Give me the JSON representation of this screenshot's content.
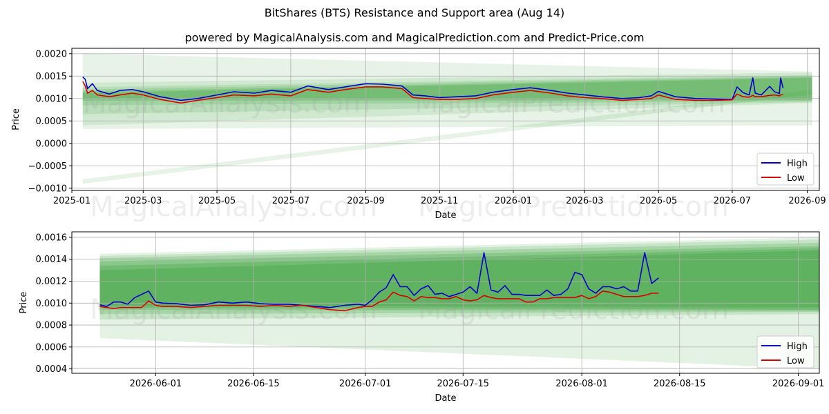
{
  "title": "BitShares (BTS) Resistance and Support area (Aug 14)",
  "subtitle": "powered by MagicalAnalysis.com and MagicalPrediction.com and Predict-Price.com",
  "watermark": [
    "MagicalAnalysis.com",
    "MagicalPrediction.com"
  ],
  "colors": {
    "high": "#0000cc",
    "low": "#dd0000",
    "band": "#2e9a2e"
  },
  "chart_data": [
    {
      "type": "line",
      "xlabel": "Date",
      "ylabel": "Price",
      "xlim": [
        "2025-01-01",
        "2026-09-11"
      ],
      "ylim": [
        -0.00105,
        0.00212
      ],
      "grid": true,
      "legend": "bottom-right",
      "x_ticks": [
        "2025-01",
        "2025-03",
        "2025-05",
        "2025-07",
        "2025-09",
        "2025-11",
        "2026-01",
        "2026-03",
        "2026-05",
        "2026-07",
        "2026-09"
      ],
      "y_ticks": [
        "0.0020",
        "0.0015",
        "0.0010",
        "0.0005",
        "0.0000",
        "−0.0005",
        "−0.0010"
      ],
      "series": [
        {
          "name": "High",
          "x": [
            "2025-01-10",
            "2025-01-12",
            "2025-01-14",
            "2025-01-18",
            "2025-01-22",
            "2025-02-01",
            "2025-02-10",
            "2025-02-20",
            "2025-03-01",
            "2025-03-15",
            "2025-04-01",
            "2025-04-15",
            "2025-05-01",
            "2025-05-15",
            "2025-06-01",
            "2025-06-15",
            "2025-07-01",
            "2025-07-15",
            "2025-08-01",
            "2025-08-15",
            "2025-09-01",
            "2025-09-15",
            "2025-10-01",
            "2025-10-10",
            "2025-10-20",
            "2025-11-01",
            "2025-11-15",
            "2025-12-01",
            "2025-12-15",
            "2026-01-01",
            "2026-01-15",
            "2026-02-01",
            "2026-02-15",
            "2026-03-01",
            "2026-03-15",
            "2026-04-01",
            "2026-04-15",
            "2026-04-25",
            "2026-05-01",
            "2026-05-15",
            "2026-06-01",
            "2026-06-15",
            "2026-07-01",
            "2026-07-05",
            "2026-07-10",
            "2026-07-15",
            "2026-07-18",
            "2026-07-20",
            "2026-07-25",
            "2026-08-01",
            "2026-08-05",
            "2026-08-09",
            "2026-08-10",
            "2026-08-12"
          ],
          "y": [
            0.00148,
            0.00143,
            0.00122,
            0.00133,
            0.00118,
            0.0011,
            0.00118,
            0.0012,
            0.00115,
            0.00104,
            0.00096,
            0.001,
            0.00108,
            0.00115,
            0.00112,
            0.00118,
            0.00114,
            0.00128,
            0.0012,
            0.00126,
            0.00133,
            0.00132,
            0.00128,
            0.00108,
            0.00106,
            0.00102,
            0.00104,
            0.00106,
            0.00114,
            0.0012,
            0.00124,
            0.00118,
            0.00112,
            0.00108,
            0.00104,
            0.001,
            0.00102,
            0.00106,
            0.00116,
            0.00104,
            0.001,
            0.00099,
            0.00098,
            0.00126,
            0.00113,
            0.00108,
            0.00146,
            0.00112,
            0.00108,
            0.00127,
            0.00115,
            0.00111,
            0.00146,
            0.00123
          ]
        },
        {
          "name": "Low",
          "x": [
            "2025-01-10",
            "2025-01-12",
            "2025-01-14",
            "2025-01-18",
            "2025-01-22",
            "2025-02-01",
            "2025-02-10",
            "2025-02-20",
            "2025-03-01",
            "2025-03-15",
            "2025-04-01",
            "2025-04-15",
            "2025-05-01",
            "2025-05-15",
            "2025-06-01",
            "2025-06-15",
            "2025-07-01",
            "2025-07-15",
            "2025-08-01",
            "2025-08-15",
            "2025-09-01",
            "2025-09-15",
            "2025-10-01",
            "2025-10-10",
            "2025-10-20",
            "2025-11-01",
            "2025-11-15",
            "2025-12-01",
            "2025-12-15",
            "2026-01-01",
            "2026-01-15",
            "2026-02-01",
            "2026-02-15",
            "2026-03-01",
            "2026-03-15",
            "2026-04-01",
            "2026-04-15",
            "2026-04-25",
            "2026-05-01",
            "2026-05-15",
            "2026-06-01",
            "2026-06-15",
            "2026-07-01",
            "2026-07-05",
            "2026-07-10",
            "2026-07-15",
            "2026-07-18",
            "2026-07-20",
            "2026-07-25",
            "2026-08-01",
            "2026-08-05",
            "2026-08-09",
            "2026-08-10",
            "2026-08-12"
          ],
          "y": [
            0.00138,
            0.00128,
            0.00112,
            0.00118,
            0.00108,
            0.00104,
            0.00108,
            0.00112,
            0.00108,
            0.00098,
            0.0009,
            0.00096,
            0.00102,
            0.00108,
            0.00106,
            0.0011,
            0.00106,
            0.0012,
            0.00114,
            0.0012,
            0.00126,
            0.00126,
            0.00122,
            0.00102,
            0.001,
            0.00098,
            0.00098,
            0.001,
            0.00108,
            0.00114,
            0.00118,
            0.00112,
            0.00106,
            0.00102,
            0.001,
            0.00096,
            0.00098,
            0.001,
            0.00108,
            0.00098,
            0.00096,
            0.00096,
            0.00097,
            0.0011,
            0.00104,
            0.00103,
            0.00107,
            0.00104,
            0.00104,
            0.00107,
            0.00108,
            0.00106,
            0.00108,
            0.00109
          ]
        }
      ]
    },
    {
      "type": "line",
      "xlabel": "Date",
      "ylabel": "Price",
      "xlim": [
        "2026-05-20",
        "2026-09-04"
      ],
      "ylim": [
        0.00036,
        0.00165
      ],
      "grid": true,
      "legend": "bottom-right",
      "x_ticks": [
        "2026-06-01",
        "2026-06-15",
        "2026-07-01",
        "2026-07-15",
        "2026-08-01",
        "2026-08-15",
        "2026-09-01"
      ],
      "y_ticks": [
        "0.0016",
        "0.0014",
        "0.0012",
        "0.0010",
        "0.0008",
        "0.0006",
        "0.0004"
      ],
      "series": [
        {
          "name": "High",
          "x": [
            "2026-05-24",
            "2026-05-25",
            "2026-05-26",
            "2026-05-27",
            "2026-05-28",
            "2026-05-29",
            "2026-05-30",
            "2026-05-31",
            "2026-06-01",
            "2026-06-02",
            "2026-06-04",
            "2026-06-06",
            "2026-06-08",
            "2026-06-10",
            "2026-06-12",
            "2026-06-14",
            "2026-06-16",
            "2026-06-18",
            "2026-06-20",
            "2026-06-22",
            "2026-06-24",
            "2026-06-26",
            "2026-06-28",
            "2026-06-30",
            "2026-07-01",
            "2026-07-02",
            "2026-07-03",
            "2026-07-04",
            "2026-07-05",
            "2026-07-06",
            "2026-07-07",
            "2026-07-08",
            "2026-07-09",
            "2026-07-10",
            "2026-07-11",
            "2026-07-12",
            "2026-07-13",
            "2026-07-14",
            "2026-07-15",
            "2026-07-16",
            "2026-07-17",
            "2026-07-18",
            "2026-07-19",
            "2026-07-20",
            "2026-07-21",
            "2026-07-22",
            "2026-07-23",
            "2026-07-24",
            "2026-07-25",
            "2026-07-26",
            "2026-07-27",
            "2026-07-28",
            "2026-07-29",
            "2026-07-30",
            "2026-07-31",
            "2026-08-01",
            "2026-08-02",
            "2026-08-03",
            "2026-08-04",
            "2026-08-05",
            "2026-08-06",
            "2026-08-07",
            "2026-08-08",
            "2026-08-09",
            "2026-08-10",
            "2026-08-11",
            "2026-08-12"
          ],
          "y": [
            0.000985,
            0.00097,
            0.00101,
            0.00101,
            0.00099,
            0.00105,
            0.00108,
            0.00111,
            0.00101,
            0.001,
            0.000995,
            0.00098,
            0.000985,
            0.00101,
            0.001,
            0.00101,
            0.000995,
            0.00099,
            0.00099,
            0.00098,
            0.00097,
            0.00096,
            0.00098,
            0.00099,
            0.00098,
            0.00103,
            0.0011,
            0.00114,
            0.00126,
            0.00115,
            0.00115,
            0.00107,
            0.00113,
            0.00116,
            0.00108,
            0.00109,
            0.00106,
            0.00108,
            0.0011,
            0.00115,
            0.00109,
            0.00146,
            0.00112,
            0.0011,
            0.00116,
            0.00108,
            0.00108,
            0.00107,
            0.00107,
            0.00107,
            0.00112,
            0.00107,
            0.00108,
            0.00113,
            0.00128,
            0.00126,
            0.00113,
            0.00109,
            0.00115,
            0.00115,
            0.00113,
            0.00115,
            0.00111,
            0.00111,
            0.00146,
            0.00118,
            0.00123
          ]
        },
        {
          "name": "Low",
          "x": [
            "2026-05-24",
            "2026-05-25",
            "2026-05-26",
            "2026-05-27",
            "2026-05-28",
            "2026-05-29",
            "2026-05-30",
            "2026-05-31",
            "2026-06-01",
            "2026-06-02",
            "2026-06-04",
            "2026-06-06",
            "2026-06-08",
            "2026-06-10",
            "2026-06-12",
            "2026-06-14",
            "2026-06-16",
            "2026-06-18",
            "2026-06-20",
            "2026-06-22",
            "2026-06-24",
            "2026-06-26",
            "2026-06-28",
            "2026-06-30",
            "2026-07-01",
            "2026-07-02",
            "2026-07-03",
            "2026-07-04",
            "2026-07-05",
            "2026-07-06",
            "2026-07-07",
            "2026-07-08",
            "2026-07-09",
            "2026-07-10",
            "2026-07-11",
            "2026-07-12",
            "2026-07-13",
            "2026-07-14",
            "2026-07-15",
            "2026-07-16",
            "2026-07-17",
            "2026-07-18",
            "2026-07-19",
            "2026-07-20",
            "2026-07-21",
            "2026-07-22",
            "2026-07-23",
            "2026-07-24",
            "2026-07-25",
            "2026-07-26",
            "2026-07-27",
            "2026-07-28",
            "2026-07-29",
            "2026-07-30",
            "2026-07-31",
            "2026-08-01",
            "2026-08-02",
            "2026-08-03",
            "2026-08-04",
            "2026-08-05",
            "2026-08-06",
            "2026-08-07",
            "2026-08-08",
            "2026-08-09",
            "2026-08-10",
            "2026-08-11",
            "2026-08-12"
          ],
          "y": [
            0.00097,
            0.00096,
            0.00095,
            0.00096,
            0.00096,
            0.00096,
            0.00096,
            0.00102,
            0.00098,
            0.00097,
            0.00097,
            0.00096,
            0.00097,
            0.00098,
            0.00098,
            0.00098,
            0.00097,
            0.00098,
            0.00097,
            0.00098,
            0.00096,
            0.00094,
            0.00093,
            0.00096,
            0.00097,
            0.00097,
            0.00101,
            0.00103,
            0.0011,
            0.00107,
            0.00106,
            0.00102,
            0.00106,
            0.00105,
            0.00105,
            0.00104,
            0.00104,
            0.00106,
            0.00103,
            0.00102,
            0.00103,
            0.00107,
            0.00105,
            0.00104,
            0.00104,
            0.00104,
            0.00104,
            0.00101,
            0.00101,
            0.00104,
            0.00104,
            0.00105,
            0.00105,
            0.00105,
            0.00105,
            0.00107,
            0.00104,
            0.00106,
            0.00111,
            0.0011,
            0.00108,
            0.00106,
            0.00106,
            0.00106,
            0.00107,
            0.00109,
            0.00109
          ]
        }
      ]
    }
  ]
}
